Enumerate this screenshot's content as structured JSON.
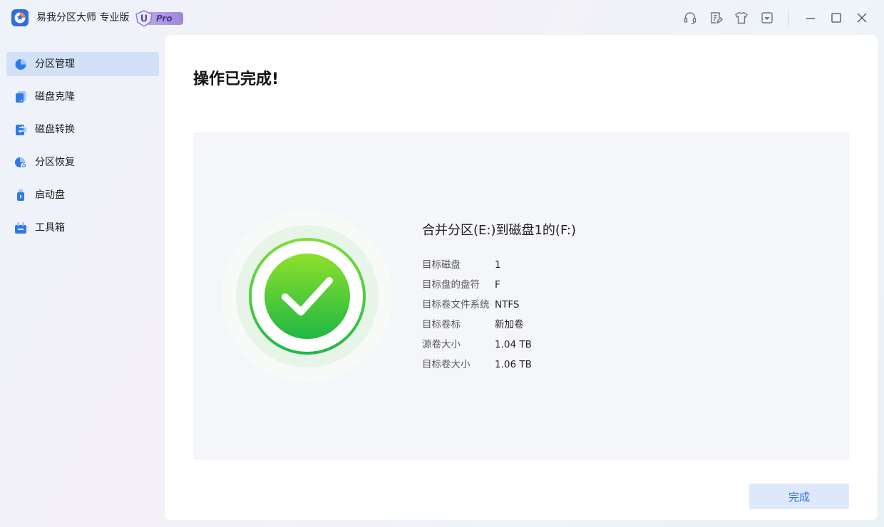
{
  "app": {
    "title": "易我分区大师 专业版",
    "badge_letter": "U",
    "badge_label": "Pro"
  },
  "titlebar_icons": [
    "headset-icon",
    "feedback-icon",
    "skin-icon",
    "menu-dropdown-icon",
    "minimize-icon",
    "maximize-icon",
    "close-icon"
  ],
  "sidebar": {
    "items": [
      {
        "label": "分区管理",
        "icon": "partition-pie-icon",
        "active": true
      },
      {
        "label": "磁盘克隆",
        "icon": "disk-clone-icon",
        "active": false
      },
      {
        "label": "磁盘转换",
        "icon": "disk-convert-icon",
        "active": false
      },
      {
        "label": "分区恢复",
        "icon": "partition-recovery-icon",
        "active": false
      },
      {
        "label": "启动盘",
        "icon": "bootable-usb-icon",
        "active": false
      },
      {
        "label": "工具箱",
        "icon": "toolbox-icon",
        "active": false
      }
    ]
  },
  "main": {
    "title": "操作已完成!",
    "operation": "合并分区(E:)到磁盘1的(F:)",
    "details": [
      {
        "key": "目标磁盘",
        "value": "1"
      },
      {
        "key": "目标盘的盘符",
        "value": "F"
      },
      {
        "key": "目标卷文件系统",
        "value": "NTFS"
      },
      {
        "key": "目标卷标",
        "value": "新加卷"
      },
      {
        "key": "源卷大小",
        "value": "1.04 TB"
      },
      {
        "key": "目标卷大小",
        "value": "1.06 TB"
      }
    ],
    "finish_label": "完成"
  },
  "colors": {
    "accent": "#2f6fdf",
    "success": "#2dbb3e",
    "nav_active_bg": "#d3e1f8"
  }
}
